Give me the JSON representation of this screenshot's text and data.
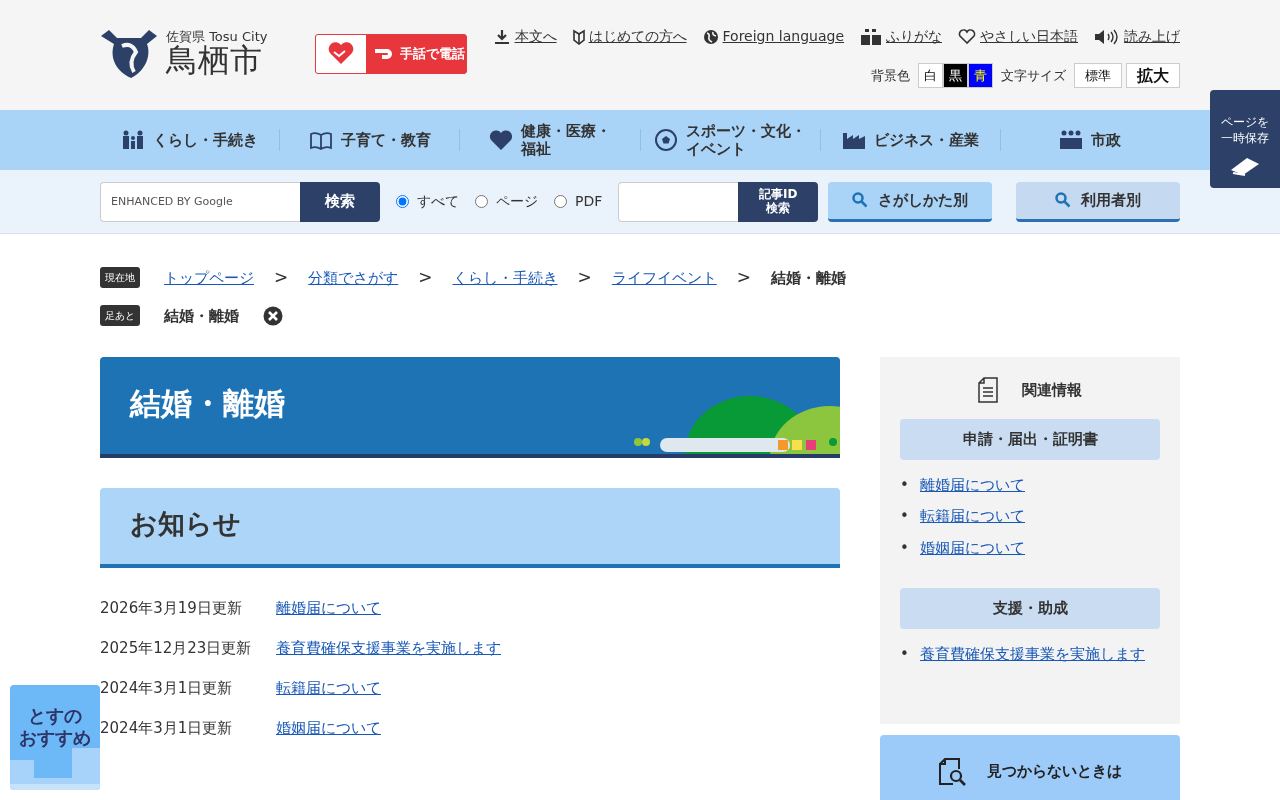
{
  "logo": {
    "prefecture": "佐賀県 Tosu City",
    "city": "鳥栖市"
  },
  "sign_language_call": {
    "label": "手話で電話"
  },
  "utility_links": [
    {
      "label": "本文へ"
    },
    {
      "label": "はじめての方へ"
    },
    {
      "label": "Foreign language"
    },
    {
      "label": "ふりがな"
    },
    {
      "label": "やさしい日本語"
    },
    {
      "label": "読み上げ"
    }
  ],
  "background_color": {
    "label": "背景色",
    "options": [
      {
        "label": "白",
        "color": "#ffffff"
      },
      {
        "label": "黒",
        "color": "#000000"
      },
      {
        "label": "青",
        "color": "#0000ff"
      }
    ]
  },
  "font_size": {
    "label": "文字サイズ",
    "options": [
      "標準",
      "拡大"
    ]
  },
  "save_page": {
    "lines": [
      "ページを",
      "一時保存"
    ]
  },
  "nav": [
    {
      "lines": [
        "くらし・手続き"
      ]
    },
    {
      "lines": [
        "子育て・教育"
      ]
    },
    {
      "lines": [
        "健康・医療・",
        "福祉"
      ]
    },
    {
      "lines": [
        "スポーツ・文化・",
        "イベント"
      ]
    },
    {
      "lines": [
        "ビジネス・産業"
      ]
    },
    {
      "lines": [
        "市政"
      ]
    }
  ],
  "search": {
    "placeholder": "ENHANCED BY Google",
    "button": "検索",
    "scopes": [
      {
        "label": "すべて",
        "selected": true
      },
      {
        "label": "ページ",
        "selected": false
      },
      {
        "label": "PDF",
        "selected": false
      }
    ],
    "id_button": [
      "記事ID",
      "検索"
    ]
  },
  "finder_buttons": [
    {
      "label": "さがしかた別",
      "color": "#a9d3f7"
    },
    {
      "label": "利用者別",
      "color": "#c5d9f1"
    }
  ],
  "breadcrumb": {
    "label": "現在地",
    "items": [
      {
        "label": "トップページ",
        "link": true
      },
      {
        "label": "分類でさがす",
        "link": true
      },
      {
        "label": "くらし・手続き",
        "link": true
      },
      {
        "label": "ライフイベント",
        "link": true
      },
      {
        "label": "結婚・離婚",
        "link": false
      }
    ],
    "separator": ">"
  },
  "footprints": {
    "label": "足あと",
    "items": [
      "結婚・離婚"
    ]
  },
  "page_title": "結婚・離婚",
  "section_heading": "お知らせ",
  "news": [
    {
      "date": "2026年3月19日更新",
      "title": "離婚届について"
    },
    {
      "date": "2025年12月23日更新",
      "title": "養育費確保支援事業を実施します"
    },
    {
      "date": "2024年3月1日更新",
      "title": "転籍届について"
    },
    {
      "date": "2024年3月1日更新",
      "title": "婚姻届について"
    }
  ],
  "sidebar": {
    "title": "関連情報",
    "bullet": "•",
    "groups": [
      {
        "heading": "申請・届出・証明書",
        "links": [
          "離婚届について",
          "転籍届について",
          "婚姻届について"
        ]
      },
      {
        "heading": "支援・助成",
        "links": [
          "養育費確保支援事業を実施します"
        ]
      }
    ],
    "help_button": "見つからないときは"
  },
  "recommend_banner": {
    "lines": [
      "とすの",
      "おすすめ"
    ]
  }
}
